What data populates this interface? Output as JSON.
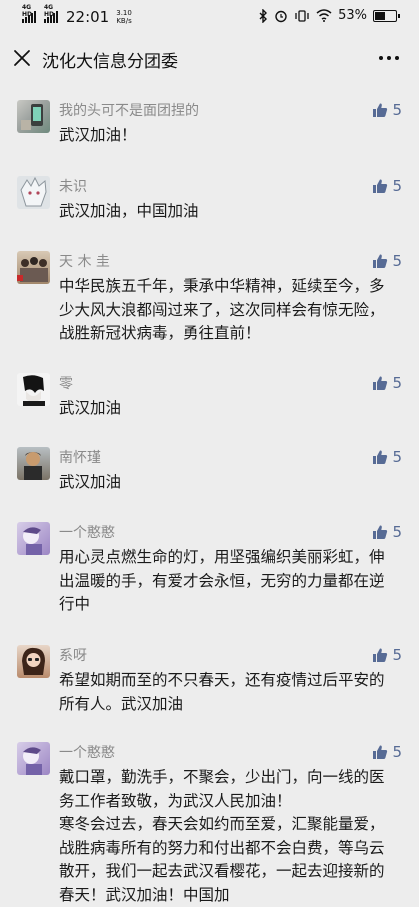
{
  "status_bar": {
    "net1": "4G HD",
    "net2": "4G HD",
    "time": "22:01",
    "speed_value": "3.10",
    "speed_unit": "KB/s",
    "battery": "53%",
    "battery_level": 0.53
  },
  "header": {
    "title": "沈化大信息分团委",
    "close_icon": "close-icon",
    "more_icon": "more-icon"
  },
  "comments": [
    {
      "author": "我的头可不是面团捏的",
      "likes": "5",
      "text": "武汉加油！"
    },
    {
      "author": "未识",
      "likes": "5",
      "text": "武汉加油，中国加油"
    },
    {
      "author": "天 木 圭",
      "likes": "5",
      "text": "中华民族五千年，秉承中华精神，延续至今，多少大风大浪都闯过来了，这次同样会有惊无险，战胜新冠状病毒，勇往直前！"
    },
    {
      "author": "零",
      "likes": "5",
      "text": "武汉加油"
    },
    {
      "author": "南怀瑾",
      "likes": "5",
      "text": "武汉加油"
    },
    {
      "author": "一个憨憨",
      "likes": "5",
      "text": "用心灵点燃生命的灯，用坚强编织美丽彩虹，伸出温暖的手，有爱才会永恒，无穷的力量都在逆行中"
    },
    {
      "author": "系呀",
      "likes": "5",
      "text": "希望如期而至的不只春天，还有疫情过后平安的所有人。武汉加油"
    },
    {
      "author": "一个憨憨",
      "likes": "5",
      "text": "戴口罩，勤洗手，不聚会，少出门，向一线的医务工作者致敬，为武汉人民加油！\n寒冬会过去，春天会如约而至爱，汇聚能量爱，战胜病毒所有的努力和付出都不会白费，等乌云散开，我们一起去武汉看樱花，一起去迎接新的春天！武汉加油！中国加"
    }
  ],
  "colors": {
    "background": "#ededed",
    "link_blue": "#576b95",
    "nick_gray": "#8a8a8a"
  }
}
